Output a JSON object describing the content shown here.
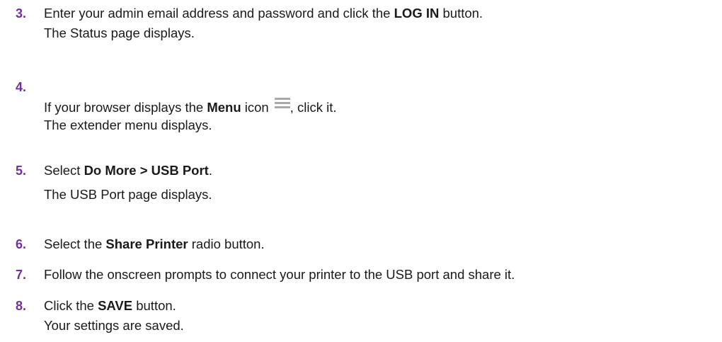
{
  "steps": [
    {
      "number": "3.",
      "line1": {
        "pre": "Enter your admin email address and password and click the ",
        "bold": "LOG IN",
        "post": " button."
      },
      "line2": "The Status page displays."
    },
    {
      "number": "4.",
      "line1": {
        "pre": "If your browser displays the ",
        "bold": "Menu",
        "mid": " icon",
        "icon": "menu-hamburger-icon",
        "post": ", click it."
      },
      "line2": "The extender menu displays."
    },
    {
      "number": "5.",
      "line1": {
        "pre": "Select ",
        "bold": "Do More > USB Port",
        "post": "."
      },
      "line2": "The USB Port page displays."
    },
    {
      "number": "6.",
      "line1": {
        "pre": "Select the ",
        "bold": "Share Printer",
        "post": " radio button."
      }
    },
    {
      "number": "7.",
      "line1": {
        "text": "Follow the onscreen prompts to connect your printer to the USB port and share it."
      }
    },
    {
      "number": "8.",
      "line1": {
        "pre": "Click the ",
        "bold": "SAVE",
        "post": " button."
      },
      "line2": "Your settings are saved."
    }
  ],
  "colors": {
    "step_number": "#6f3199",
    "body_text": "#1a1a1a",
    "icon": "#a9a9a9"
  }
}
